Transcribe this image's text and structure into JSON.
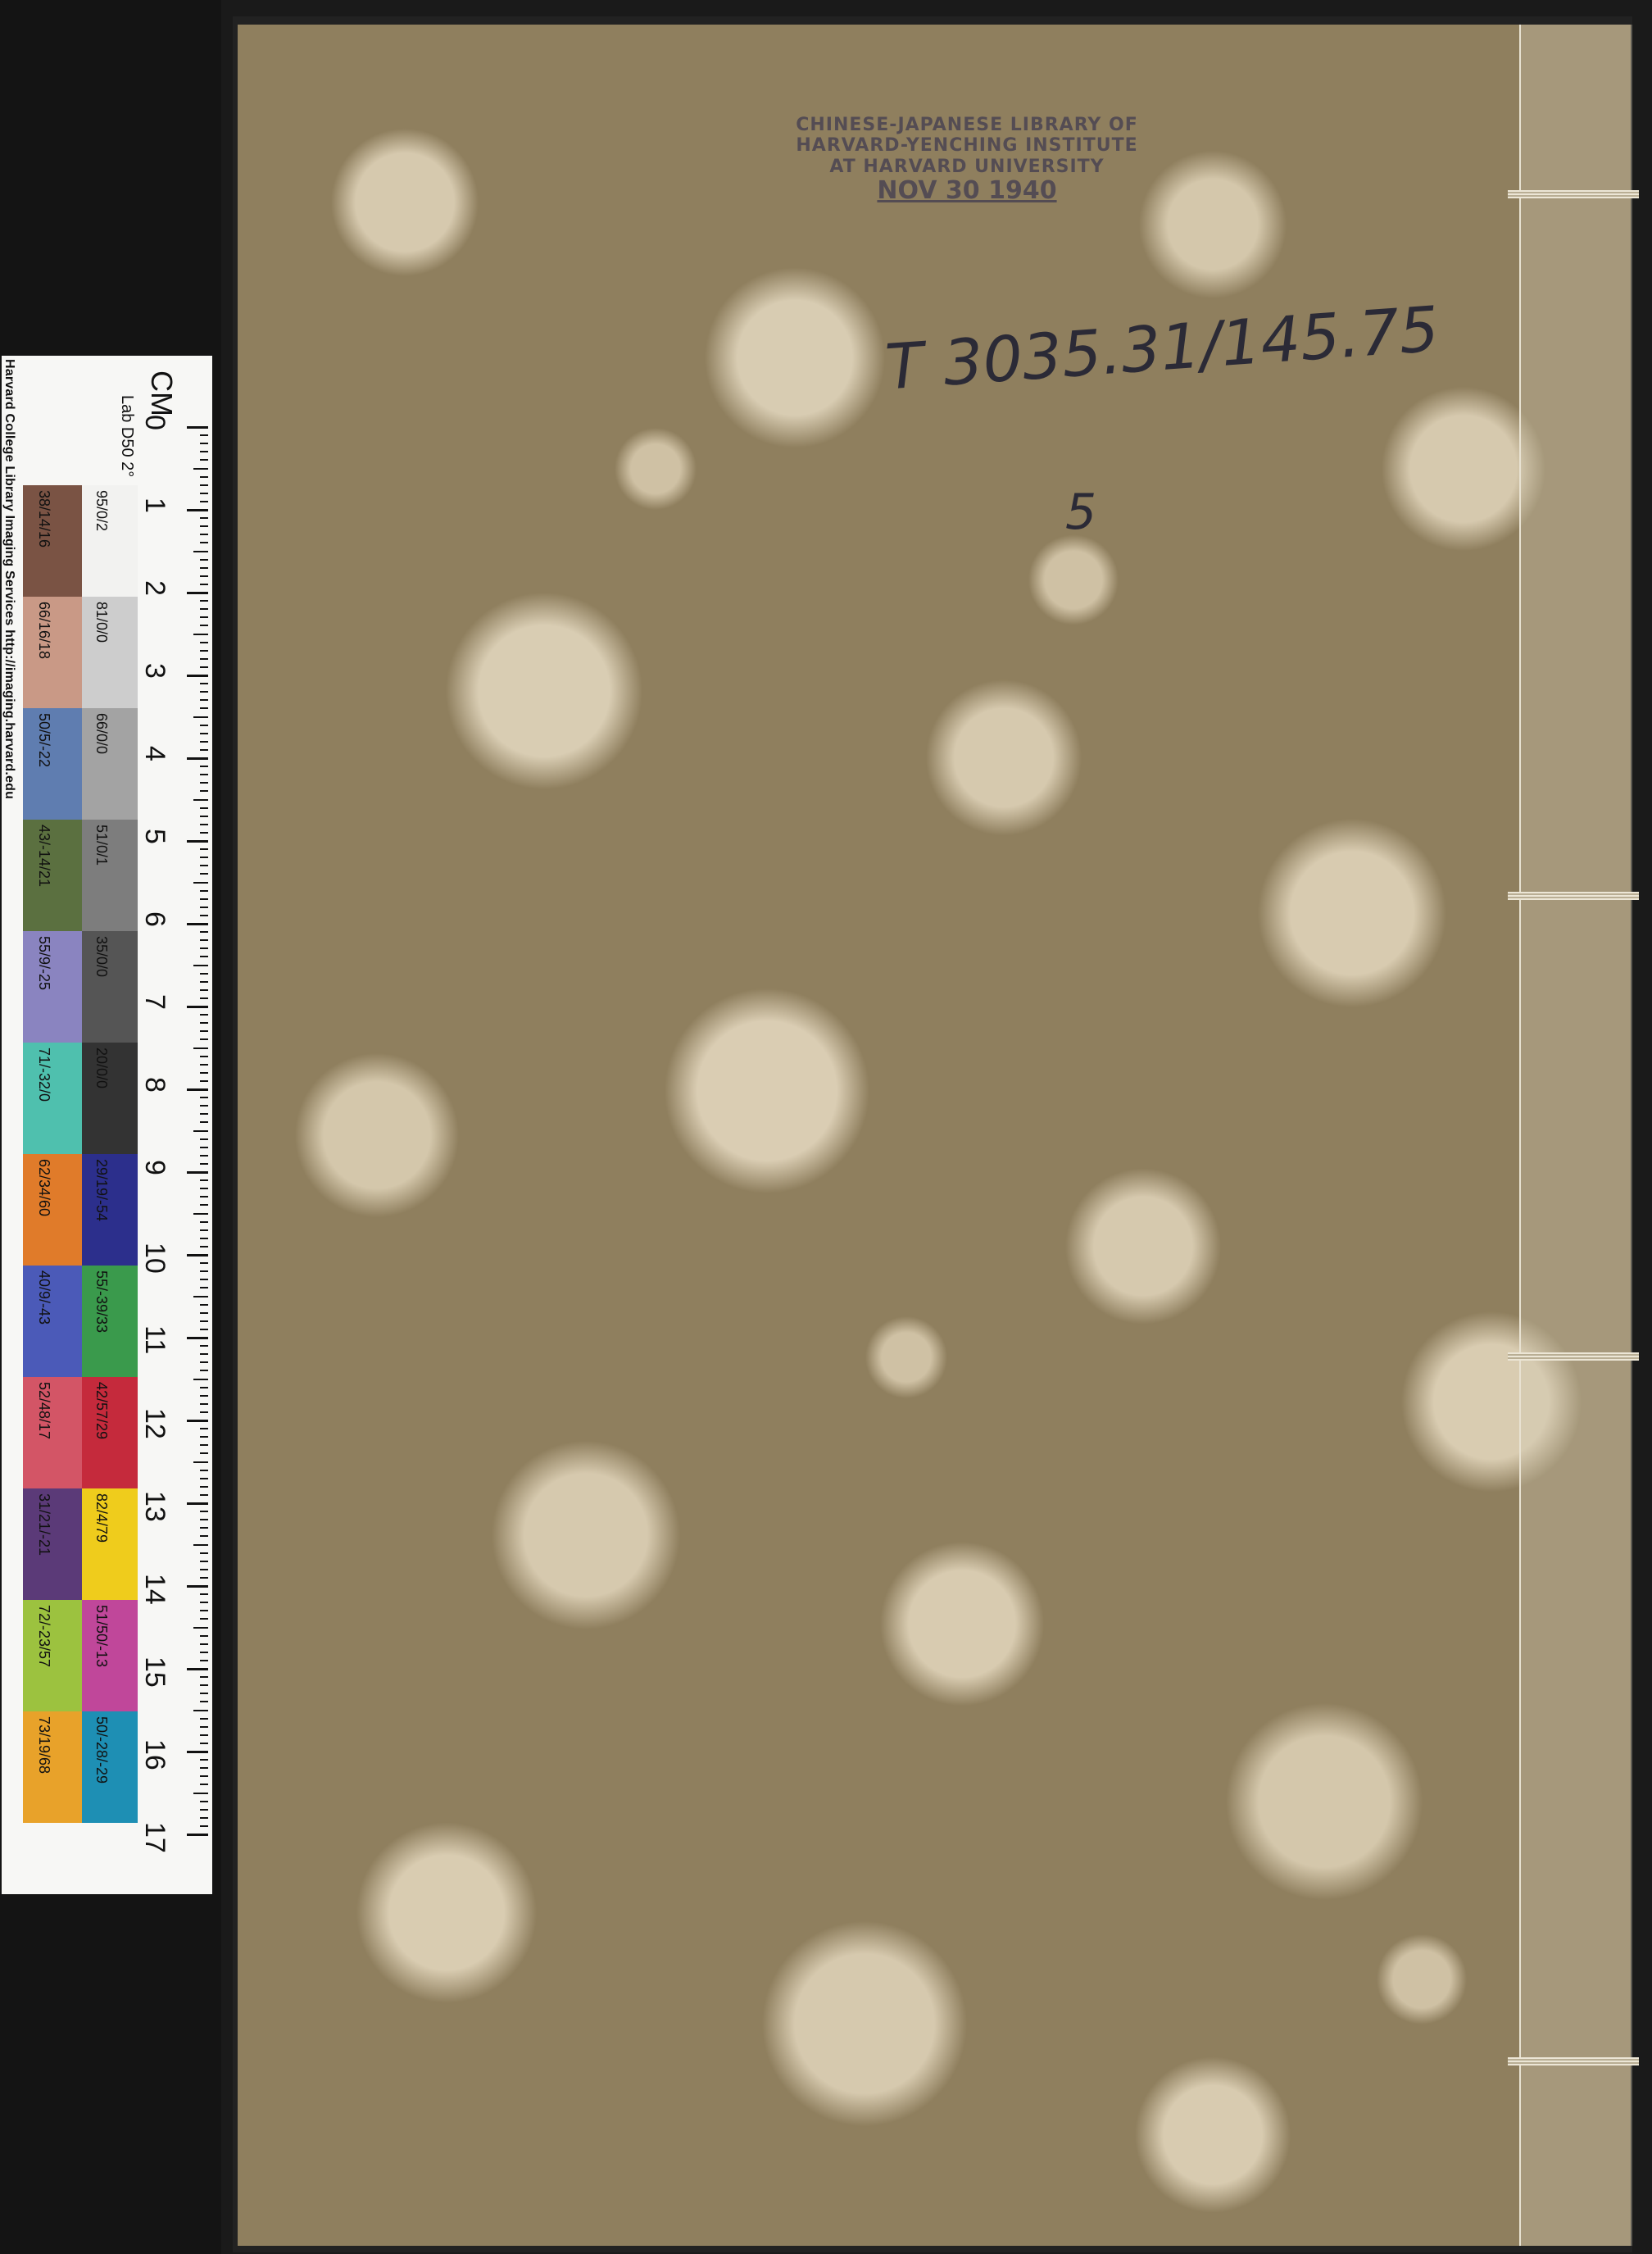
{
  "scale_card": {
    "credit": "Harvard College Library Imaging Services http://imaging.harvard.edu",
    "unit_label": "CM",
    "lab_label": "Lab D50 2°",
    "ruler_numbers": [
      "0",
      "1",
      "2",
      "3",
      "4",
      "5",
      "6",
      "7",
      "8",
      "9",
      "10",
      "11",
      "12",
      "13",
      "14",
      "15",
      "16",
      "17"
    ],
    "color_swatches": [
      {
        "label": "38/14/16",
        "color": "#7a5344"
      },
      {
        "label": "66/16/18",
        "color": "#c99986"
      },
      {
        "label": "50/5/-22",
        "color": "#5f7db0"
      },
      {
        "label": "43/-14/21",
        "color": "#5b7040"
      },
      {
        "label": "55/9/-25",
        "color": "#8a84c0"
      },
      {
        "label": "71/-32/0",
        "color": "#4fc0ae"
      },
      {
        "label": "62/34/60",
        "color": "#e07b2a"
      },
      {
        "label": "40/9/-43",
        "color": "#4b5ab8"
      },
      {
        "label": "52/48/17",
        "color": "#d35566"
      },
      {
        "label": "31/21/-21",
        "color": "#5b3a78"
      },
      {
        "label": "72/-23/57",
        "color": "#9cc23f"
      },
      {
        "label": "73/19/68",
        "color": "#e8a22a"
      }
    ],
    "gray_swatches": [
      {
        "label": "95/0/2",
        "color": "#f2f2f0"
      },
      {
        "label": "81/0/0",
        "color": "#cdcdcd"
      },
      {
        "label": "66/0/0",
        "color": "#a3a3a3"
      },
      {
        "label": "51/0/1",
        "color": "#7d7d7d"
      },
      {
        "label": "35/0/0",
        "color": "#555555"
      },
      {
        "label": "20/0/0",
        "color": "#333333"
      },
      {
        "label": "29/19/-54",
        "color": "#2c2f8c"
      },
      {
        "label": "55/-39/33",
        "color": "#3a9a4c"
      },
      {
        "label": "42/57/29",
        "color": "#c52a3c"
      },
      {
        "label": "82/4/79",
        "color": "#efcc1c"
      },
      {
        "label": "51/50/-13",
        "color": "#c0479a"
      },
      {
        "label": "50/-28/-29",
        "color": "#1e8fb4"
      }
    ]
  },
  "cover": {
    "stamp_line1": "CHINESE-JAPANESE LIBRARY OF",
    "stamp_line2": "HARVARD-YENCHING INSTITUTE",
    "stamp_line3": "AT HARVARD UNIVERSITY",
    "stamp_date": "NOV 30 1940",
    "call_number": "T 3035.31/145.75",
    "volume_number": "5"
  }
}
